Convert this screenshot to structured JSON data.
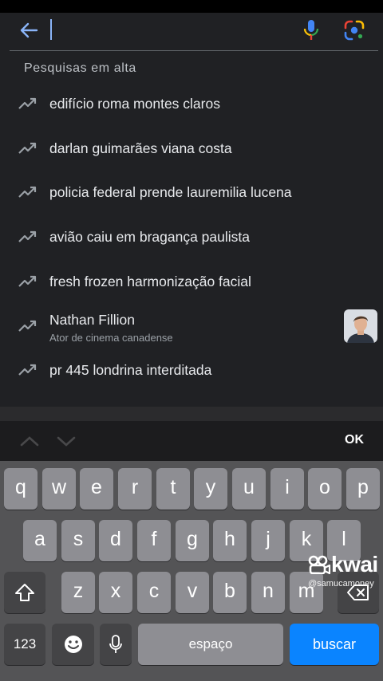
{
  "search": {
    "value": ""
  },
  "section_title": "Pesquisas em alta",
  "suggestions": [
    {
      "text": "edifício roma montes claros"
    },
    {
      "text": "darlan guimarães viana costa"
    },
    {
      "text": "policia federal prende lauremilia lucena"
    },
    {
      "text": "avião caiu em bragança paulista"
    },
    {
      "text": "fresh frozen harmonização facial"
    },
    {
      "title": "Nathan Fillion",
      "subtitle": "Ator de cinema canadense"
    },
    {
      "text": "pr 445 londrina interditada"
    }
  ],
  "accessory": {
    "ok_label": "OK"
  },
  "keyboard": {
    "row1": [
      "q",
      "w",
      "e",
      "r",
      "t",
      "y",
      "u",
      "i",
      "o",
      "p"
    ],
    "row2": [
      "a",
      "s",
      "d",
      "f",
      "g",
      "h",
      "j",
      "k",
      "l"
    ],
    "row3": [
      "z",
      "x",
      "c",
      "v",
      "b",
      "n",
      "m"
    ],
    "numbers_label": "123",
    "space_label": "espaço",
    "go_label": "buscar"
  },
  "watermark": {
    "brand": "kwai",
    "handle": "@samucamoney"
  },
  "colors": {
    "accent_blue": "#0a84ff",
    "caret": "#8ab4f8",
    "panel_bg": "#202124",
    "keyboard_bg": "#545456"
  },
  "icons": [
    "back-arrow-icon",
    "microphone-icon",
    "google-lens-icon",
    "trending-icon",
    "chevron-up-icon",
    "chevron-down-icon",
    "shift-icon",
    "backspace-icon",
    "emoji-icon",
    "dictation-mic-icon"
  ]
}
